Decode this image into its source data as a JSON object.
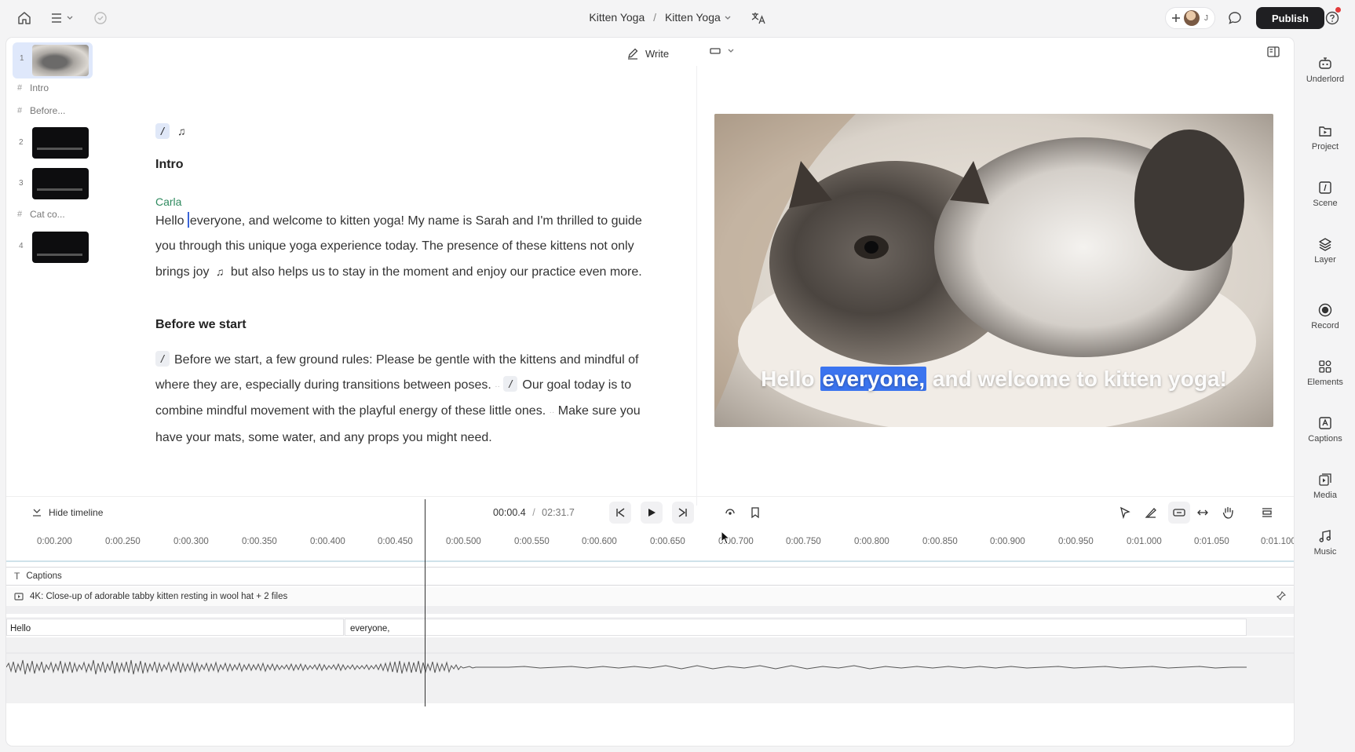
{
  "topbar": {
    "project": "Kitten Yoga",
    "separator": "/",
    "composition": "Kitten Yoga",
    "avatar_initial": "J",
    "publish_label": "Publish"
  },
  "slides": [
    {
      "number": "1"
    },
    {
      "label": "Intro"
    },
    {
      "label": "Before..."
    },
    {
      "number": "2"
    },
    {
      "number": "3"
    },
    {
      "label": "Cat co..."
    },
    {
      "number": "4"
    }
  ],
  "editor": {
    "write_label": "Write",
    "sections": [
      {
        "heading": "Intro",
        "speaker": "Carla",
        "text_before_caret": "Hello ",
        "text_after_caret": "everyone, and welcome to kitten yoga! My name is Sarah and I'm thrilled to guide you through this unique yoga experience today. The presence of these kittens not only brings joy ",
        "text_tail": " but also helps us to stay in the moment and enjoy our practice even more."
      },
      {
        "heading": "Before we start",
        "text_1": "Before we start, a few ground rules: Please be gentle with the kittens and mindful of where they are, especially during transitions between poses.",
        "text_2": "Our goal today is to combine mindful movement with the playful energy of these little ones.",
        "text_3": "Make sure you have your mats, some water, and any props you might need."
      }
    ]
  },
  "preview": {
    "caption_before": "Hello ",
    "caption_highlight": "everyone,",
    "caption_after": " and welcome to kitten yoga!"
  },
  "timeline": {
    "hide_label": "Hide timeline",
    "current_time": "00:00.4",
    "time_sep": "/",
    "total_time": "02:31.7",
    "ticks": [
      "0:00.200",
      "0:00.250",
      "0:00.300",
      "0:00.350",
      "0:00.400",
      "0:00.450",
      "0:00.500",
      "0:00.550",
      "0:00.600",
      "0:00.650",
      "0:00.700",
      "0:00.750",
      "0:00.800",
      "0:00.850",
      "0:00.900",
      "0:00.950",
      "0:01.000",
      "0:01.050",
      "0:01.100"
    ],
    "captions_track_label": "Captions",
    "media_track_label": "4K: Close-up of adorable tabby kitten resting in wool hat + 2 files",
    "word_1": "Hello",
    "word_2": "everyone,"
  },
  "right_sidebar": [
    {
      "label": "Underlord",
      "icon": "robot-icon"
    },
    {
      "label": "Project",
      "icon": "project-icon"
    },
    {
      "label": "Scene",
      "icon": "scene-icon"
    },
    {
      "label": "Layer",
      "icon": "layer-icon"
    },
    {
      "label": "Record",
      "icon": "record-icon"
    },
    {
      "label": "Elements",
      "icon": "elements-icon"
    },
    {
      "label": "Captions",
      "icon": "captions-icon"
    },
    {
      "label": "Media",
      "icon": "media-icon"
    },
    {
      "label": "Music",
      "icon": "music-icon"
    }
  ],
  "colors": {
    "accent": "#3b74ef",
    "speaker": "#2f8a5f",
    "publish_bg": "#1f1f22",
    "notification": "#e23b3b"
  }
}
